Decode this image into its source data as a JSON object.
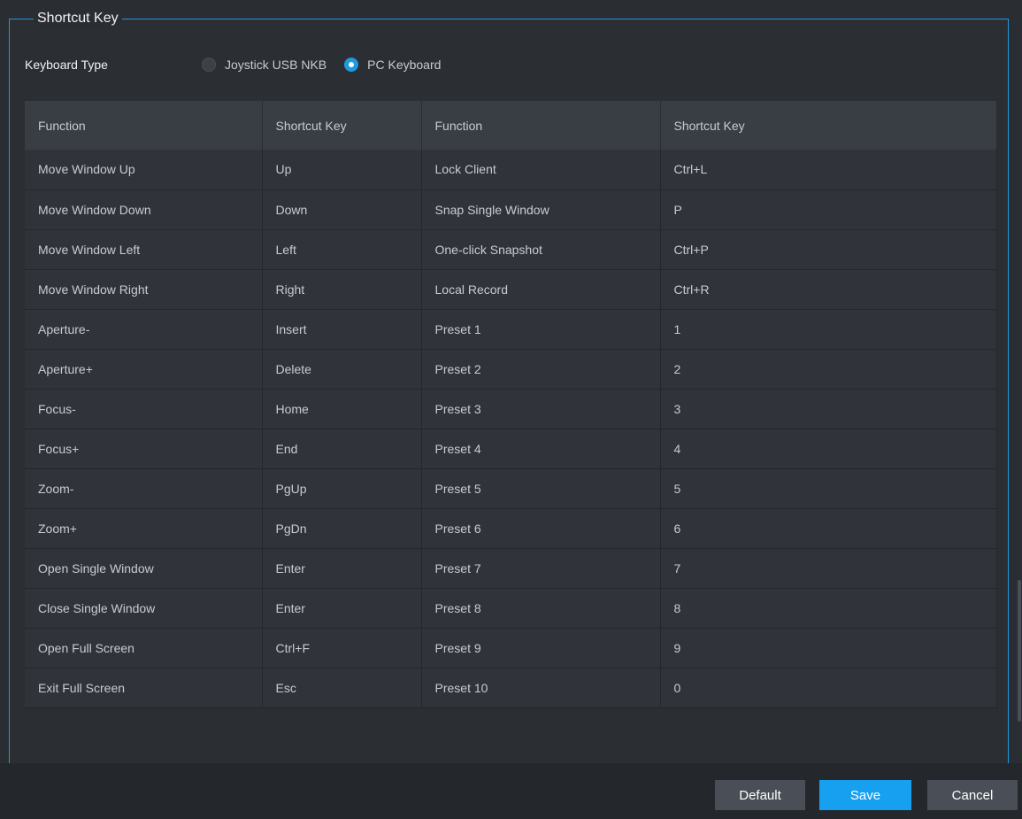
{
  "panel": {
    "title": "Shortcut Key"
  },
  "keyboard_type": {
    "label": "Keyboard Type",
    "options": [
      {
        "label": "Joystick USB NKB",
        "selected": false
      },
      {
        "label": "PC Keyboard",
        "selected": true
      }
    ]
  },
  "table": {
    "headers": [
      "Function",
      "Shortcut Key",
      "Function",
      "Shortcut Key"
    ],
    "rows": [
      [
        "Move Window Up",
        "Up",
        "Lock Client",
        "Ctrl+L"
      ],
      [
        "Move Window Down",
        "Down",
        "Snap Single Window",
        "P"
      ],
      [
        "Move Window Left",
        "Left",
        "One-click Snapshot",
        "Ctrl+P"
      ],
      [
        "Move Window Right",
        "Right",
        "Local Record",
        "Ctrl+R"
      ],
      [
        "Aperture-",
        "Insert",
        "Preset 1",
        "1"
      ],
      [
        "Aperture+",
        "Delete",
        "Preset 2",
        "2"
      ],
      [
        "Focus-",
        "Home",
        "Preset 3",
        "3"
      ],
      [
        "Focus+",
        "End",
        "Preset 4",
        "4"
      ],
      [
        "Zoom-",
        "PgUp",
        "Preset 5",
        "5"
      ],
      [
        "Zoom+",
        "PgDn",
        "Preset 6",
        "6"
      ],
      [
        "Open Single Window",
        "Enter",
        "Preset 7",
        "7"
      ],
      [
        "Close Single Window",
        "Enter",
        "Preset 8",
        "8"
      ],
      [
        "Open Full Screen",
        "Ctrl+F",
        "Preset 9",
        "9"
      ],
      [
        "Exit Full Screen",
        "Esc",
        "Preset 10",
        "0"
      ]
    ]
  },
  "buttons": {
    "default": "Default",
    "save": "Save",
    "cancel": "Cancel"
  },
  "colors": {
    "accent": "#1e9ae0",
    "save_button": "#18a0f0",
    "background": "#2a2d32"
  }
}
